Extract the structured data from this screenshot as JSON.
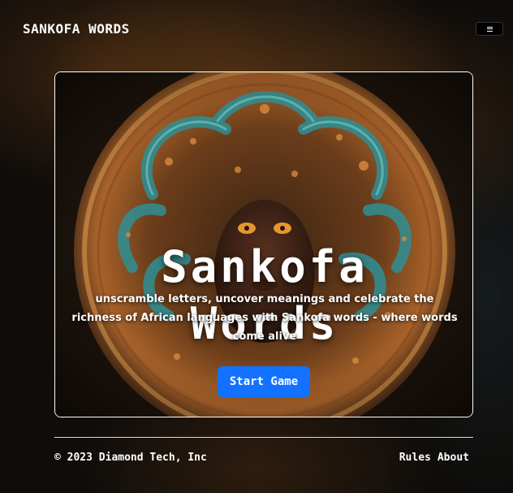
{
  "nav": {
    "brand": "SANKOFA WORDS",
    "menu_icon": "hamburger-menu-icon"
  },
  "hero": {
    "title_line1": "Sankofa",
    "title_line2": "Words",
    "tagline_line1": "unscramble letters, uncover meanings and celebrate the",
    "tagline_line2": "richness of African languages with Sankofa words - where words",
    "tagline_line3": "come alive",
    "start_label": "Start Game"
  },
  "footer": {
    "copyright": "© 2023 Diamond Tech, Inc",
    "links": [
      "Rules",
      "About"
    ]
  },
  "colors": {
    "accent": "#1272ff",
    "text": "#ffffff",
    "background": "#14110e",
    "art_copper": "#c87a35",
    "art_teal": "#2f8f95"
  }
}
